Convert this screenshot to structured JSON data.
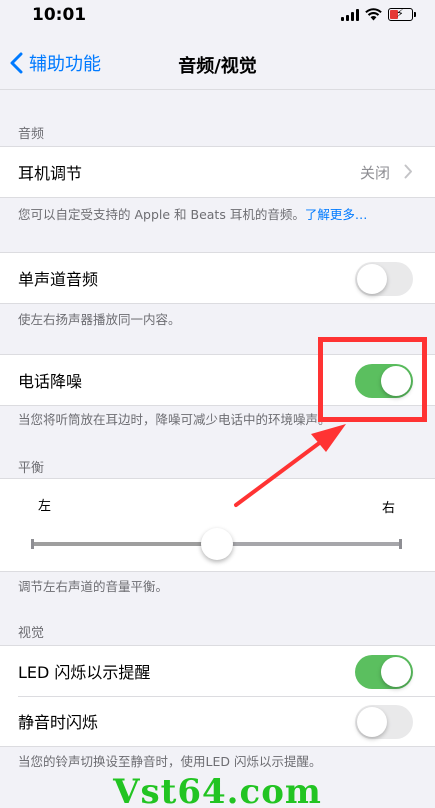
{
  "status": {
    "time": "10:01"
  },
  "nav": {
    "back_label": "辅助功能",
    "title": "音频/视觉"
  },
  "audio": {
    "header": "音频",
    "headphone_label": "耳机调节",
    "headphone_value": "关闭",
    "headphone_note": "您可以自定受支持的 Apple 和 Beats 耳机的音频。",
    "headphone_link": "了解更多…"
  },
  "mono": {
    "label": "单声道音频",
    "enabled": false,
    "note": "使左右扬声器播放同一内容。"
  },
  "phone_noise": {
    "label": "电话降噪",
    "enabled": true,
    "note": "当您将听筒放在耳边时，降噪可减少电话中的环境噪声。"
  },
  "balance": {
    "header": "平衡",
    "left_label": "左",
    "right_label": "右",
    "value": 0.5,
    "note": "调节左右声道的音量平衡。"
  },
  "visual": {
    "header": "视觉",
    "led_label": "LED 闪烁以示提醒",
    "led_enabled": true,
    "silent_label": "静音时闪烁",
    "silent_enabled": false,
    "note": "当您的铃声切换设至静音时，使用LED 闪烁以示提醒。"
  },
  "annotation_color": "#ff3333",
  "toggle_on_color": "#5bbf5f",
  "watermark": "Vst64.com"
}
